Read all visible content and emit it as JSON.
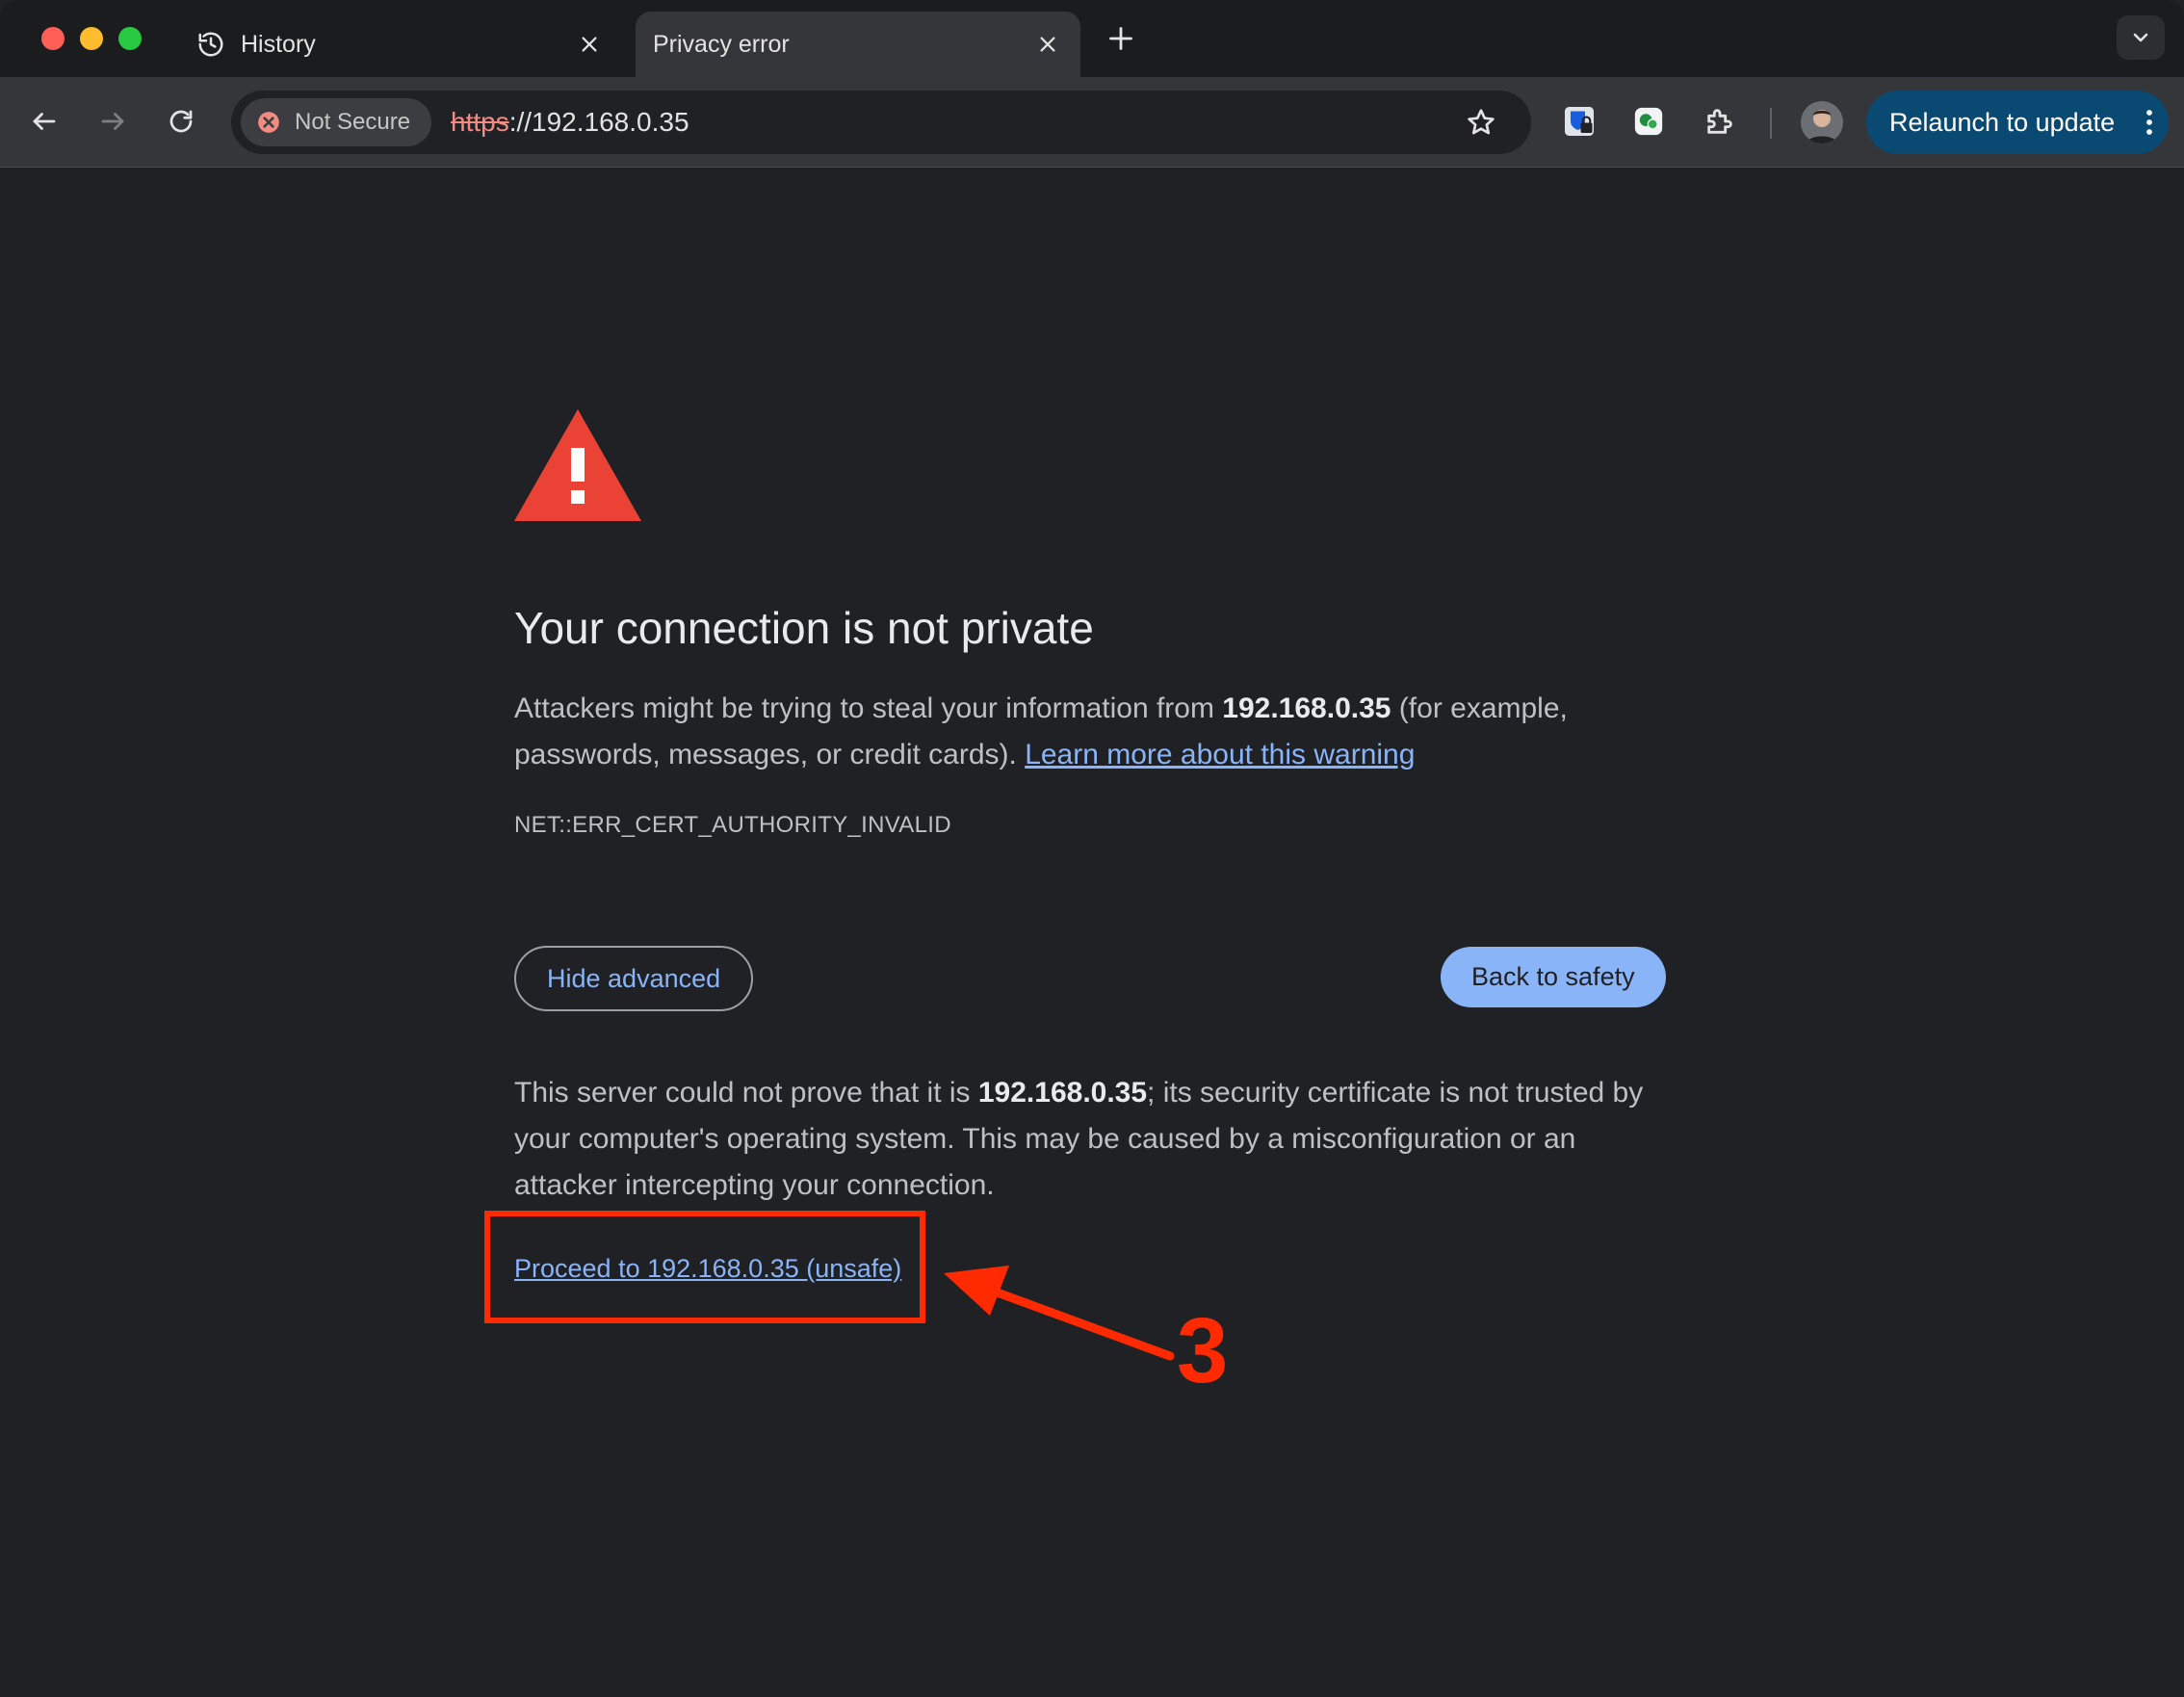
{
  "window": {
    "traffic_lights": {
      "close": "#ff5f57",
      "minimize": "#febc2e",
      "zoom": "#28c840"
    }
  },
  "tabs": [
    {
      "title": "History",
      "icon": "history-icon",
      "active": false
    },
    {
      "title": "Privacy error",
      "icon": "none",
      "active": true
    }
  ],
  "toolbar": {
    "security_chip": {
      "label": "Not Secure",
      "icon": "not-secure-icon"
    },
    "url": {
      "scheme": "https",
      "rest": "://192.168.0.35"
    },
    "relaunch_label": "Relaunch to update"
  },
  "page": {
    "heading": "Your connection is not private",
    "intro_before": "Attackers might be trying to steal your information from ",
    "host": "192.168.0.35",
    "intro_after": " (for example, passwords, messages, or credit cards). ",
    "learn_more": "Learn more about this warning",
    "error_code": "NET::ERR_CERT_AUTHORITY_INVALID",
    "hide_advanced": "Hide advanced",
    "back_to_safety": "Back to safety",
    "detail_before": "This server could not prove that it is ",
    "detail_host": "192.168.0.35",
    "detail_after": "; its security certificate is not trusted by your computer's operating system. This may be caused by a misconfiguration or an attacker intercepting your connection.",
    "proceed": "Proceed to 192.168.0.35 (unsafe)"
  },
  "annotation": {
    "step": "3",
    "color": "#ff2a00"
  },
  "colors": {
    "background": "#202124",
    "link": "#8ab4f8",
    "warning": "#ea4335",
    "relaunch": "#0a4a72"
  }
}
